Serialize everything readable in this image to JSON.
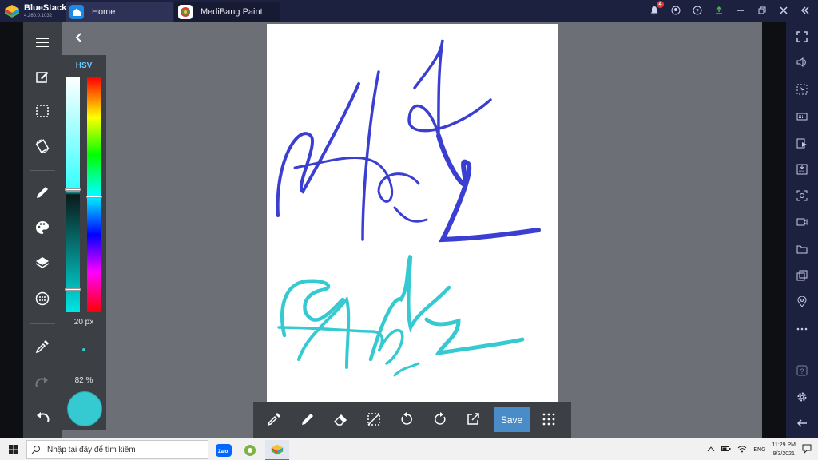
{
  "titlebar": {
    "app_name": "BlueStacks",
    "version": "4.260.0.1032",
    "tabs": [
      {
        "label": "Home",
        "icon": "home-icon"
      },
      {
        "label": "MediBang Paint",
        "icon": "medibang-icon"
      }
    ],
    "notification_count": "4",
    "icons": [
      "bell-icon",
      "account-icon",
      "help-icon",
      "update-icon",
      "minimize-icon",
      "restore-icon",
      "close-icon",
      "collapse-icon"
    ]
  },
  "left_toolbar": {
    "icons": [
      "menu-icon",
      "edit-icon",
      "selection-icon",
      "rotate-canvas-icon",
      "pen-icon",
      "palette-icon",
      "layers-icon",
      "material-icon",
      "eyedropper-icon",
      "redo-icon",
      "undo-icon"
    ]
  },
  "color_panel": {
    "mode_label": "HSV",
    "brush_size": "20 px",
    "opacity": "82 %",
    "current_color": "#35c9d1",
    "saturation_level": 0.48,
    "hue_level": 0.51,
    "value_level": 0.9
  },
  "canvas": {
    "stroke_colors": {
      "top": "#3b3fd1",
      "bottom": "#35c9d1"
    }
  },
  "bottom_toolbar": {
    "icons": [
      "eyedropper-icon",
      "pen-icon",
      "eraser-icon",
      "deselect-icon",
      "rotate-left-icon",
      "rotate-right-icon",
      "export-icon",
      "grid-icon"
    ],
    "save_label": "Save"
  },
  "right_sidebar": {
    "icons": [
      "fullscreen-icon",
      "volume-icon",
      "cursor-icon",
      "keyboard-icon",
      "media-icon",
      "apk-install-icon",
      "screenshot-icon",
      "video-icon",
      "folder-icon",
      "multi-instance-icon",
      "location-icon",
      "more-icon",
      "help-icon",
      "settings-icon",
      "back-icon"
    ]
  },
  "taskbar": {
    "search_placeholder": "Nhập tại đây để tìm kiếm",
    "language": "ENG",
    "time": "11:29 PM",
    "date": "9/3/2021"
  },
  "colors": {
    "accent": "#4a8cc7",
    "panel": "#3c3f44",
    "bluestacks_bg": "#1d2140"
  }
}
